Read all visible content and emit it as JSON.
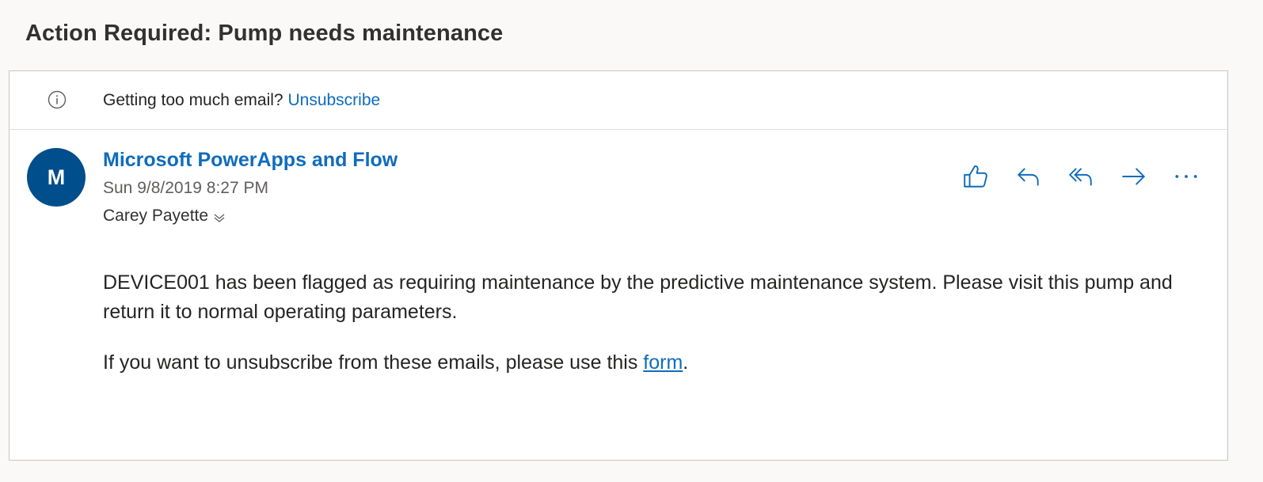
{
  "subject": "Action Required: Pump needs maintenance",
  "info_bar": {
    "text": "Getting too much email?",
    "link_label": "Unsubscribe",
    "icon": "info-icon"
  },
  "message": {
    "avatar_initial": "M",
    "avatar_color": "#004e8c",
    "sender": "Microsoft PowerApps and Flow",
    "date": "Sun 9/8/2019 8:27 PM",
    "recipient": "Carey Payette",
    "actions": [
      {
        "name": "like",
        "icon": "thumbs-up-icon"
      },
      {
        "name": "reply",
        "icon": "reply-icon"
      },
      {
        "name": "reply-all",
        "icon": "reply-all-icon"
      },
      {
        "name": "forward",
        "icon": "forward-icon"
      },
      {
        "name": "more",
        "icon": "more-icon"
      }
    ]
  },
  "body": {
    "paragraph1": "DEVICE001 has been flagged as requiring maintenance by the predictive maintenance system. Please visit this pump and return it to normal operating parameters.",
    "paragraph2_prefix": "If you want to unsubscribe from these emails, please use this ",
    "paragraph2_link": "form",
    "paragraph2_suffix": "."
  },
  "colors": {
    "accent": "#0f6cbd",
    "background": "#faf9f8",
    "card": "#ffffff"
  }
}
